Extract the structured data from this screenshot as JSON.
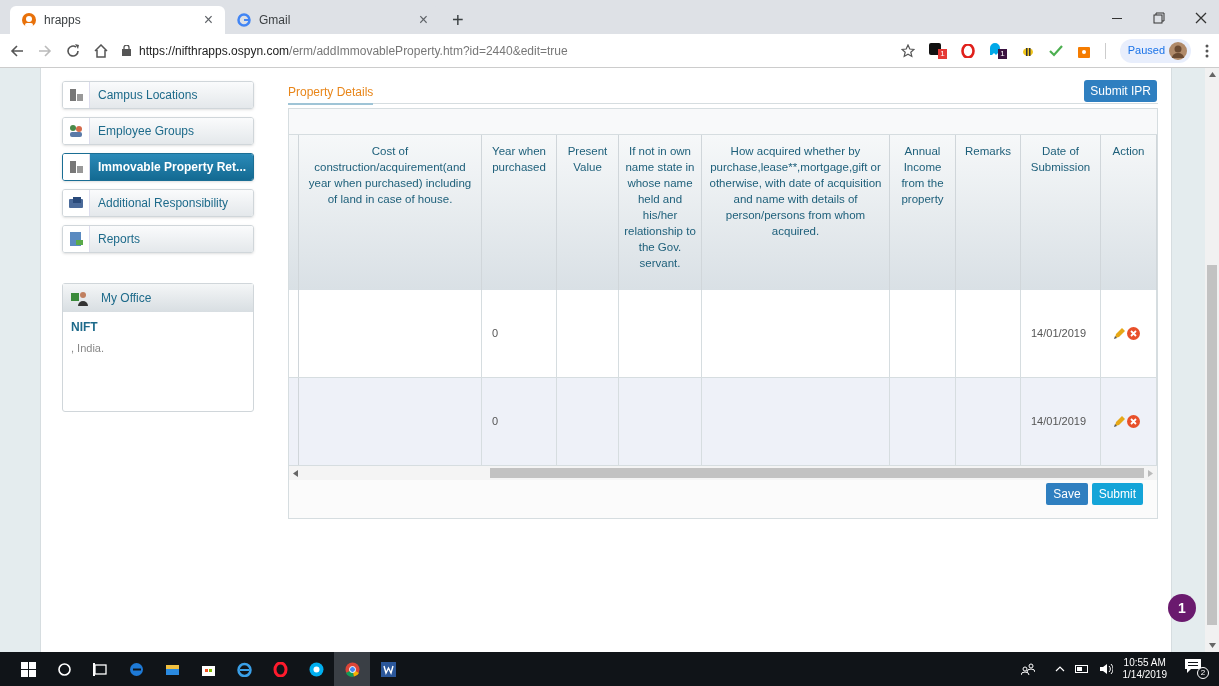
{
  "browser": {
    "tabs": [
      {
        "title": "hrapps",
        "selected": true,
        "close": "×"
      },
      {
        "title": "Gmail",
        "selected": false,
        "close": "×"
      }
    ],
    "new_tab": "+",
    "url_host": "https://nifthrapps.ospyn.com",
    "url_path": "/erm/addImmovableProperty.htm?id=2440&edit=true",
    "extension_badges": [
      "1",
      "1"
    ],
    "profile": "Paused"
  },
  "sidebar": {
    "items": [
      {
        "label": "Campus Locations",
        "selected": false
      },
      {
        "label": "Employee Groups",
        "selected": false
      },
      {
        "label": "Immovable Property Ret...",
        "selected": true
      },
      {
        "label": "Additional Responsibility",
        "selected": false
      },
      {
        "label": "Reports",
        "selected": false
      }
    ],
    "office": {
      "title": "My Office",
      "name": "NIFT",
      "address": ", India."
    }
  },
  "main": {
    "tab": "Property Details",
    "submit_ipr": "Submit IPR",
    "table": {
      "columns": [
        "Cost of construction/acquirement(and year when purchased) including of land in case of house.",
        "Year when purchased",
        "Present Value",
        "If not in own name state in whose name held and his/her relationship to the Gov. servant.",
        "How acquired whether by purchase,lease**,mortgage,gift or otherwise, with date of acquisition and name with details of person/persons from whom acquired.",
        "Annual Income from the property",
        "Remarks",
        "Date of Submission",
        "Action"
      ],
      "rows": [
        {
          "year": "0",
          "date": "14/01/2019"
        },
        {
          "year": "0",
          "date": "14/01/2019"
        }
      ]
    },
    "buttons": [
      "Save",
      "Submit"
    ]
  },
  "floating_badge": "1",
  "taskbar": {
    "time": "10:55 AM",
    "date": "1/14/2019",
    "notifications": "2"
  }
}
